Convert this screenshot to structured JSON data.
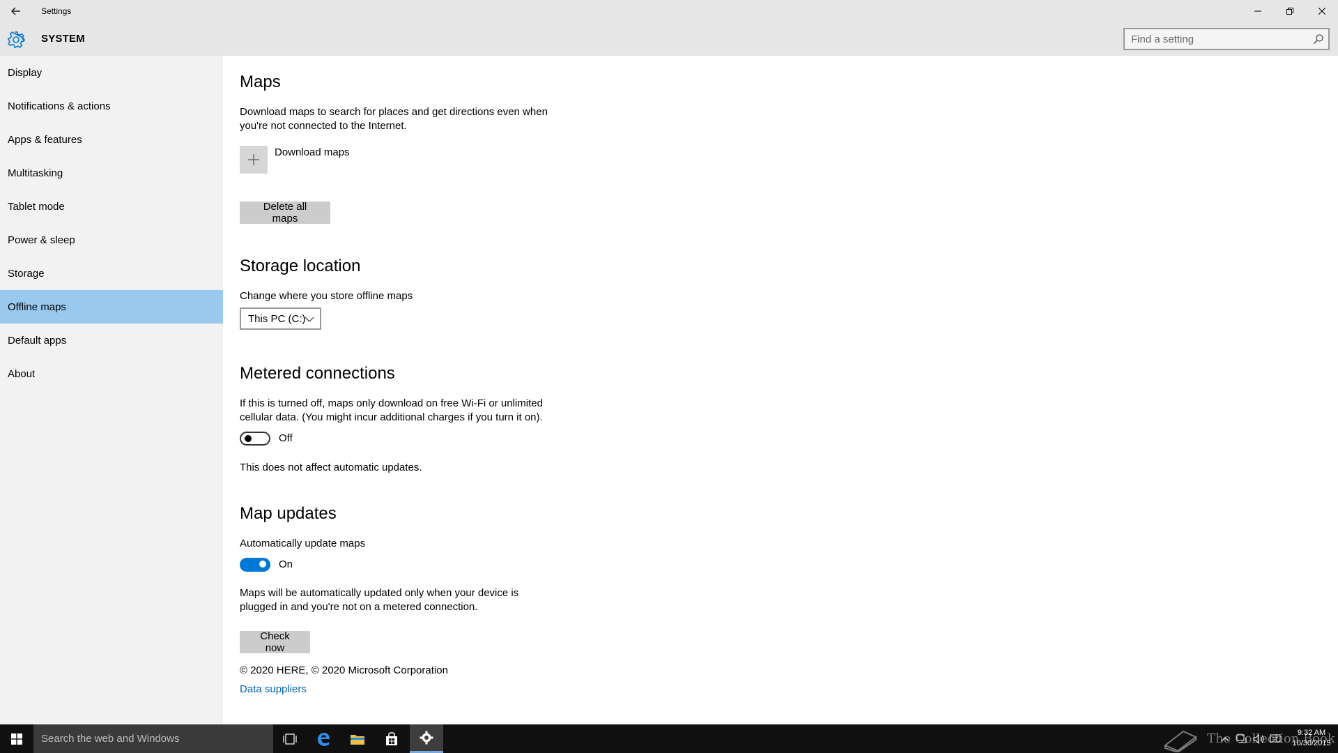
{
  "window": {
    "title": "Settings",
    "app_title": "SYSTEM",
    "search_placeholder": "Find a setting",
    "accent_color": "#0078d7",
    "selected_nav_color": "#99c9ef"
  },
  "sidebar": {
    "items": [
      {
        "label": "Display"
      },
      {
        "label": "Notifications & actions"
      },
      {
        "label": "Apps & features"
      },
      {
        "label": "Multitasking"
      },
      {
        "label": "Tablet mode"
      },
      {
        "label": "Power & sleep"
      },
      {
        "label": "Storage"
      },
      {
        "label": "Offline maps",
        "selected": true
      },
      {
        "label": "Default apps"
      },
      {
        "label": "About"
      }
    ]
  },
  "maps": {
    "heading": "Maps",
    "description": "Download maps to search for places and get directions even when you're not connected to the Internet.",
    "download_label": "Download maps",
    "delete_label": "Delete all maps"
  },
  "storage": {
    "heading": "Storage location",
    "description": "Change where you store offline maps",
    "selected": "This PC (C:)"
  },
  "metered": {
    "heading": "Metered connections",
    "description": "If this is turned off, maps only download on free Wi-Fi or unlimited cellular data. (You might incur additional charges if you turn it on).",
    "toggle_state": "Off",
    "toggle_on": false,
    "note": "This does not affect automatic updates."
  },
  "updates": {
    "heading": "Map updates",
    "description": "Automatically update maps",
    "toggle_state": "On",
    "toggle_on": true,
    "note": "Maps will be automatically updated only when your device is plugged in and you're not on a metered connection.",
    "check_label": "Check now"
  },
  "footer": {
    "copyright": "© 2020 HERE, © 2020 Microsoft Corporation",
    "link": "Data suppliers"
  },
  "taskbar": {
    "search_placeholder": "Search the web and Windows",
    "time": "9:32 AM",
    "date": "10/30/2015",
    "watermark": "The Collection Book"
  }
}
